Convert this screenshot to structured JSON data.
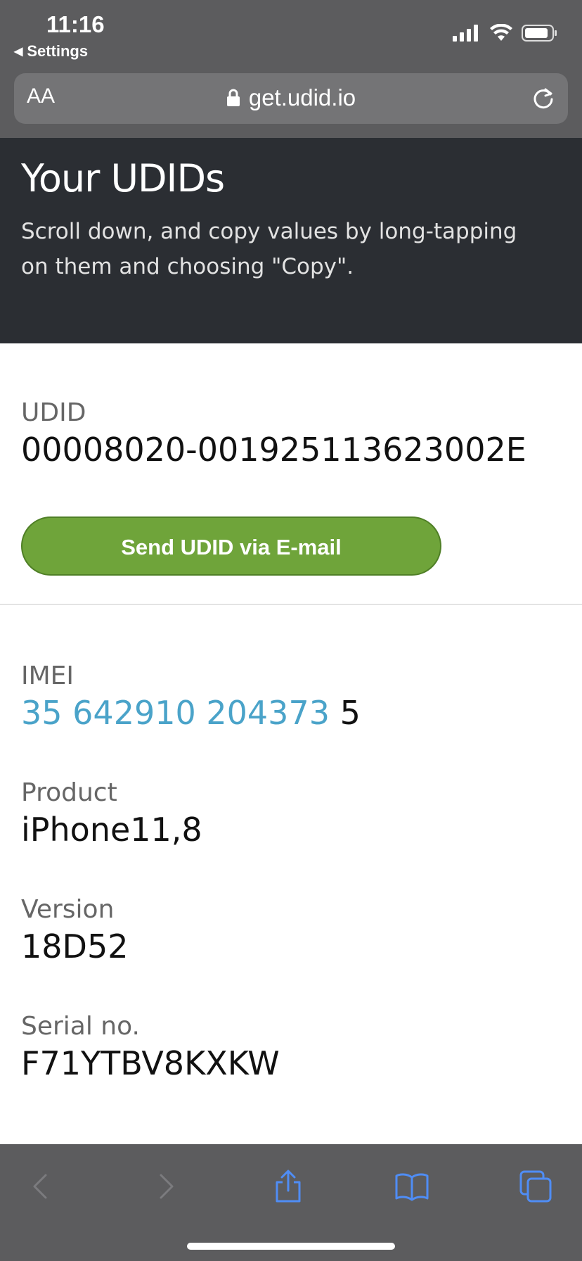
{
  "status": {
    "time": "11:16",
    "back_label": "Settings"
  },
  "browser": {
    "text_size_label": "AA",
    "url": "get.udid.io"
  },
  "hero": {
    "title": "Your UDIDs",
    "subtitle": "Scroll down, and copy values by long-tapping on them and choosing \"Copy\"."
  },
  "udid": {
    "label": "UDID",
    "value": "00008020-001925113623002E",
    "send_button": "Send UDID via E-mail"
  },
  "imei": {
    "label": "IMEI",
    "value_linked": "35 642910 204373",
    "value_suffix": " 5"
  },
  "product": {
    "label": "Product",
    "value": "iPhone11,8"
  },
  "version": {
    "label": "Version",
    "value": "18D52"
  },
  "serial": {
    "label": "Serial no.",
    "value": "F71YTBV8KXKW"
  },
  "toolbar": {
    "icons": [
      "back-icon",
      "forward-icon",
      "share-icon",
      "bookmarks-icon",
      "tabs-icon"
    ]
  },
  "colors": {
    "chrome_bg": "#5c5c5e",
    "hero_bg": "#2b2e33",
    "button_green": "#6fa43a",
    "link_blue": "#4aa3c9",
    "toolbar_icon_blue": "#4f8df5"
  }
}
